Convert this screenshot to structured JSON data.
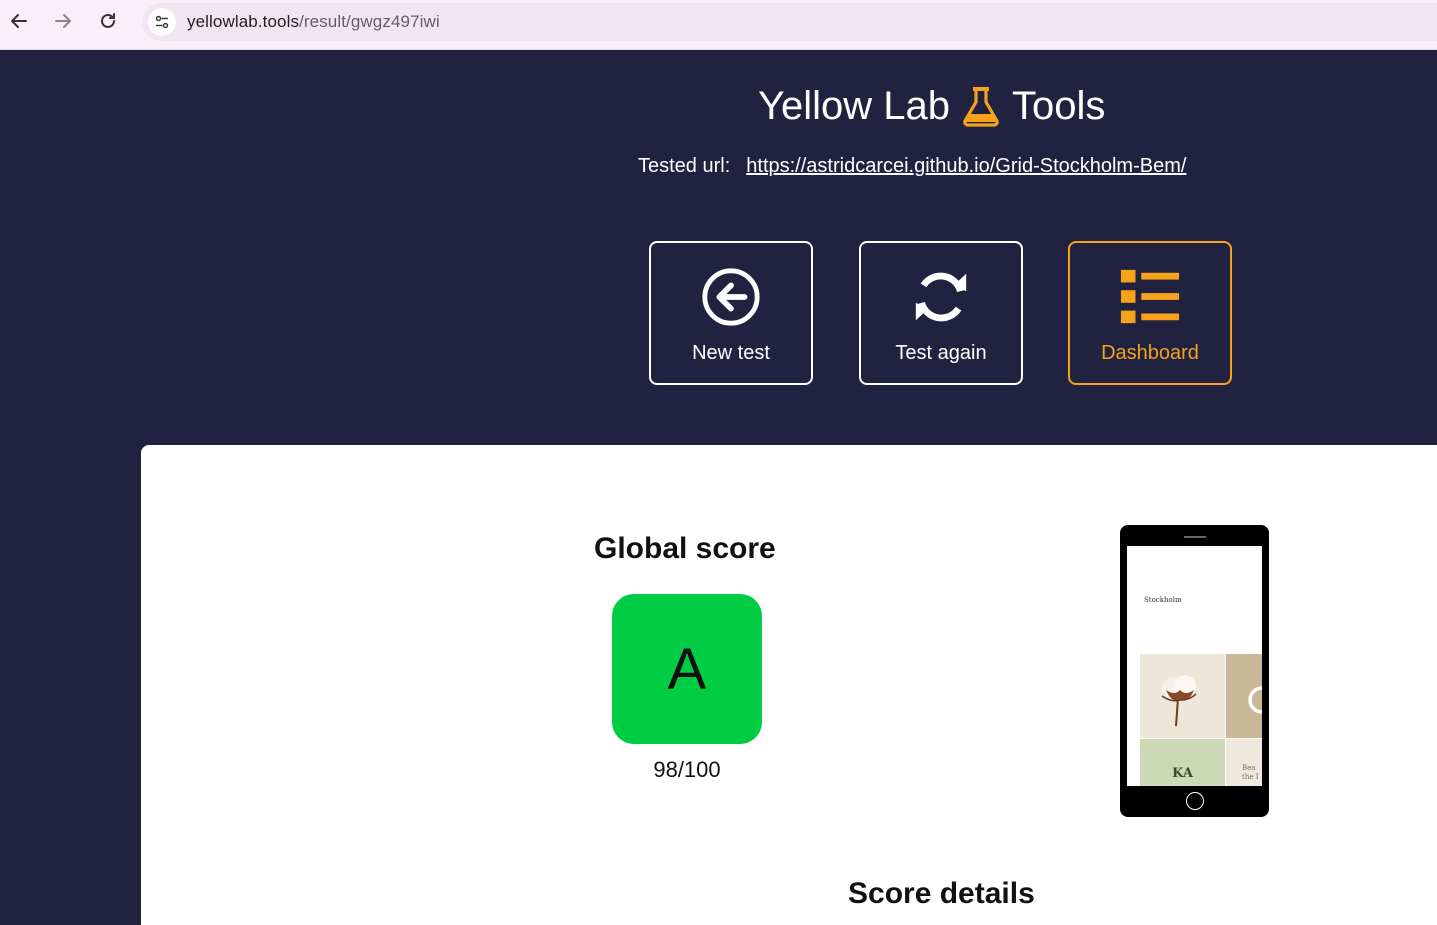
{
  "browser": {
    "url_host": "yellowlab.tools",
    "url_path": "/result/gwgz497iwi",
    "icons": [
      "back-arrow-icon",
      "forward-arrow-icon",
      "reload-icon",
      "site-info-icon"
    ]
  },
  "header": {
    "title_left": "Yellow Lab",
    "title_right": "Tools",
    "tested_label": "Tested url:",
    "tested_url": "https://astridcarcei.github.io/Grid-Stockholm-Bem/"
  },
  "actions": {
    "new_test": "New test",
    "test_again": "Test again",
    "dashboard": "Dashboard"
  },
  "results": {
    "global_score_title": "Global score",
    "grade": "A",
    "score": "98/100",
    "score_details_title": "Score details"
  },
  "screenshot": {
    "brand": "Stockholm",
    "tile_text_1": "KA",
    "tile_text_2": "Bea the I"
  },
  "colors": {
    "background": "#212240",
    "accent": "#f7a21b",
    "grade_a": "#00cc44"
  }
}
